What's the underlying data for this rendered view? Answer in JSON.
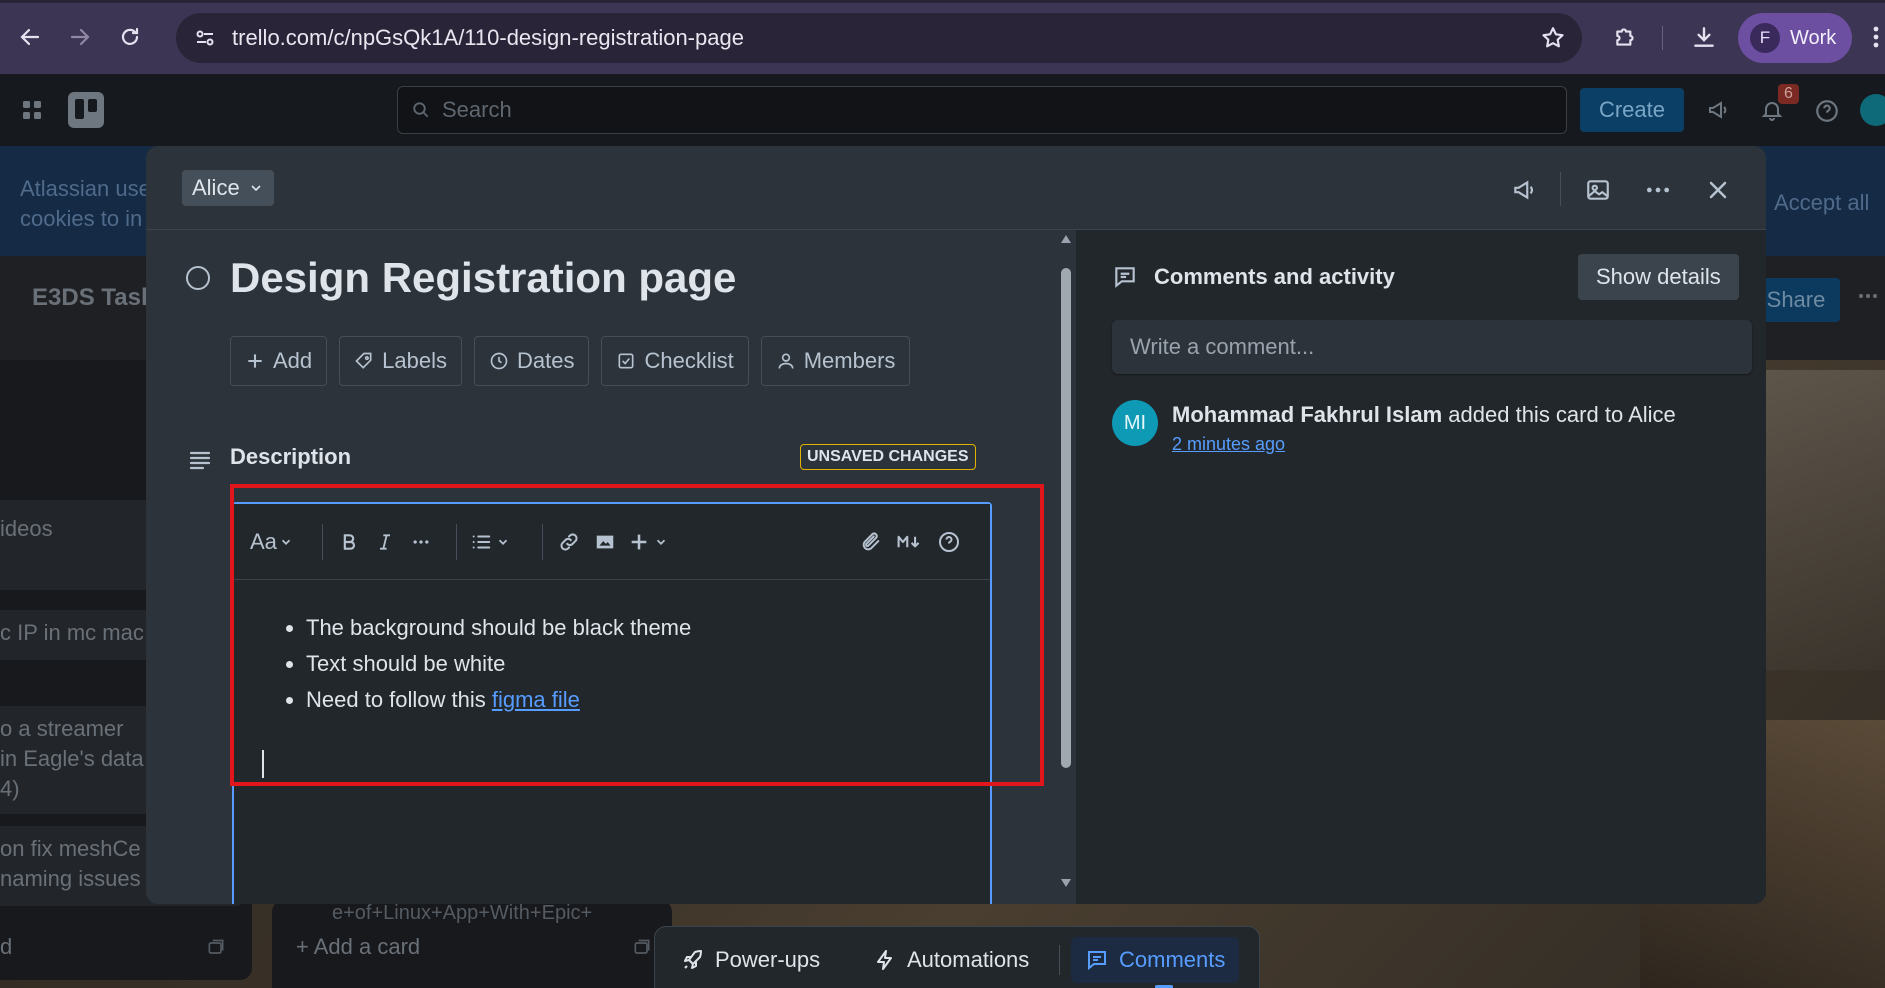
{
  "browser": {
    "url": "trello.com/c/npGsQk1A/110-design-registration-page",
    "profile_initial": "F",
    "profile_label": "Work"
  },
  "header": {
    "search_placeholder": "Search",
    "create_label": "Create",
    "notification_count": "6"
  },
  "cookie_banner": {
    "text_line1": "Atlassian use",
    "text_line2": "cookies to in",
    "accept_all": "Accept all"
  },
  "board": {
    "title": "E3DS Task",
    "share_label": "Share",
    "cards": [
      {
        "text": "ideos"
      },
      {
        "text": "c IP in mc mac"
      },
      {
        "text": "o a streamer\nin Eagle's data\n4)"
      },
      {
        "text": "on fix meshCe\nnaming issues"
      }
    ],
    "add_card_left": "d",
    "add_card": "+ Add a card",
    "partial_card_text": "e+of+Linux+App+With+Epic+"
  },
  "modal": {
    "list_name": "Alice",
    "title": "Design Registration page",
    "actions": [
      {
        "label": "Add"
      },
      {
        "label": "Labels"
      },
      {
        "label": "Dates"
      },
      {
        "label": "Checklist"
      },
      {
        "label": "Members"
      }
    ],
    "description_heading": "Description",
    "unsaved_badge": "UNSAVED CHANGES",
    "editor": {
      "text_style_label": "Aa",
      "bullets": [
        "The background should be black theme",
        "Text should be white"
      ],
      "bullet3_prefix": "Need to follow this ",
      "bullet3_link": "figma file"
    },
    "activity": {
      "heading": "Comments and activity",
      "show_details": "Show details",
      "comment_placeholder": "Write a comment...",
      "avatar_initials": "MI",
      "user": "Mohammad Fakhrul Islam",
      "action": " added this card to Alice",
      "time": "2 minutes ago"
    }
  },
  "bottom_bar": {
    "powerups": "Power-ups",
    "automations": "Automations",
    "comments": "Comments"
  },
  "colors": {
    "accent_blue": "#579dff",
    "highlight_red": "#e0161c",
    "unsaved_yellow": "#e2b203"
  }
}
